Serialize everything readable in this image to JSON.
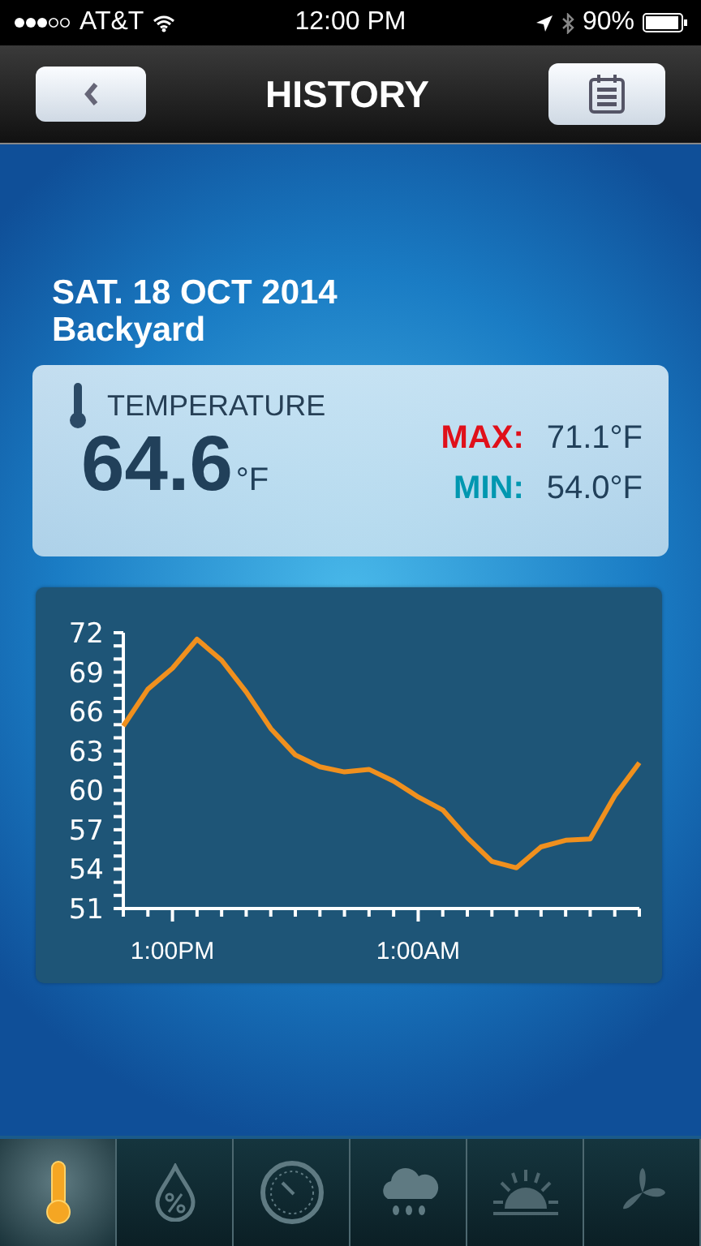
{
  "status_bar": {
    "carrier": "AT&T",
    "time": "12:00 PM",
    "battery": "90%"
  },
  "nav": {
    "title": "HISTORY"
  },
  "header": {
    "date": "SAT. 18 OCT 2014",
    "location": "Backyard"
  },
  "reading": {
    "label": "TEMPERATURE",
    "value": "64.6",
    "unit": "°F",
    "max_label": "MAX:",
    "max_value": "71.1°F",
    "min_label": "MIN:",
    "min_value": "54.0°F"
  },
  "chart": {
    "chart_data": {
      "type": "line",
      "categories": [
        null,
        null,
        "1:00PM",
        null,
        null,
        null,
        null,
        null,
        null,
        null,
        null,
        null,
        "1:00AM",
        null,
        null,
        null,
        null,
        null,
        null,
        null,
        null,
        null
      ],
      "series": [
        {
          "color": "#f0901e",
          "values": [
            64.9,
            67.7,
            69.3,
            71.5,
            69.9,
            67.5,
            64.7,
            62.7,
            61.8,
            61.4,
            61.6,
            60.7,
            59.5,
            58.5,
            56.4,
            54.6,
            54.1,
            55.7,
            56.2,
            56.3,
            59.6,
            62.1
          ]
        }
      ],
      "ylim": [
        51,
        72
      ],
      "yticks": [
        51,
        54,
        57,
        60,
        63,
        66,
        69,
        72
      ]
    }
  },
  "tabs": [
    {
      "kind": "thermometer",
      "selected": true
    },
    {
      "kind": "humidity",
      "selected": false
    },
    {
      "kind": "pressure",
      "selected": false
    },
    {
      "kind": "rain",
      "selected": false
    },
    {
      "kind": "uv",
      "selected": false
    },
    {
      "kind": "wind",
      "selected": false
    }
  ]
}
